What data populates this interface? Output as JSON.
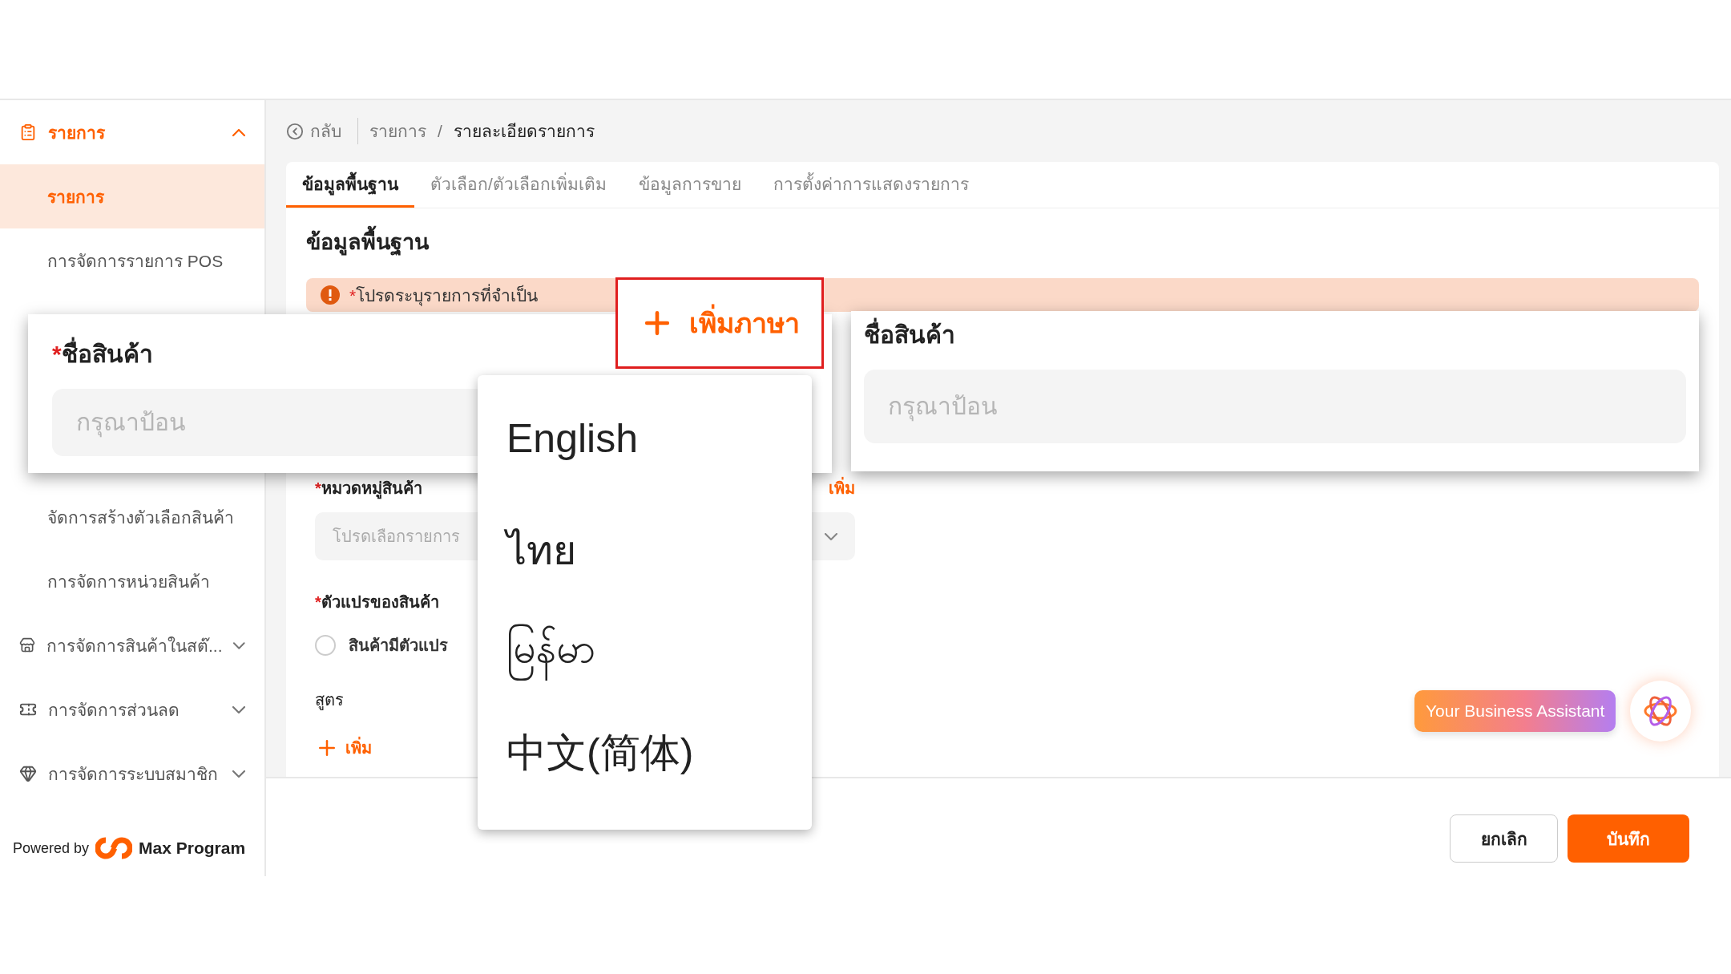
{
  "sidebar": {
    "group": {
      "label": "รายการ",
      "expanded": true
    },
    "items": [
      {
        "label": "รายการ",
        "selected": true
      },
      {
        "label": "การจัดการรายการ POS",
        "selected": false
      },
      {
        "label": "จัดการสร้างตัวเลือกสินค้า",
        "selected": false
      },
      {
        "label": "การจัดการหน่วยสินค้า",
        "selected": false
      }
    ],
    "sections": [
      {
        "kind": "store",
        "label": "การจัดการสินค้าในสต๊...",
        "expanded": false
      },
      {
        "kind": "discount",
        "label": "การจัดการส่วนลด",
        "expanded": false
      },
      {
        "kind": "member",
        "label": "การจัดการระบบสมาชิก",
        "expanded": false
      }
    ],
    "powered_by": "Powered by",
    "brand": "Max Program"
  },
  "breadcrumb": {
    "back": "กลับ",
    "items": [
      "รายการ",
      "รายละเอียดรายการ"
    ],
    "separator": "/"
  },
  "tabs": [
    {
      "label": "ข้อมูลพื้นฐาน",
      "selected": true
    },
    {
      "label": "ตัวเลือก/ตัวเลือกเพิ่มเติม",
      "selected": false
    },
    {
      "label": "ข้อมูลการขาย",
      "selected": false
    },
    {
      "label": "การตั้งค่าการแสดงรายการ",
      "selected": false
    }
  ],
  "section_title": "ข้อมูลพื้นฐาน",
  "alert": {
    "mark": "*",
    "text": "โปรดระบุรายการที่จำเป็น"
  },
  "category": {
    "mark": "*",
    "label": "หมวดหมู่สินค้า",
    "action": "เพิ่ม",
    "placeholder": "โปรดเลือกรายการ"
  },
  "variant": {
    "mark": "*",
    "label": "ตัวแปรของสินค้า",
    "option": {
      "label": "สินค้ามีตัวแปร",
      "checked": false
    }
  },
  "recipe": {
    "label": "สูตร",
    "add": "เพิ่ม"
  },
  "footer": {
    "cancel": "ยกเลิก",
    "save": "บันทึก"
  },
  "assistant": {
    "label": "Your Business Assistant"
  },
  "callouts": {
    "name_left": {
      "mark": "*",
      "label": "ชื่อสินค้า",
      "placeholder": "กรุณาป้อน"
    },
    "add_language": {
      "label": "เพิ่มภาษา"
    },
    "languages": [
      "English",
      "ไทย",
      "မြန်မာ",
      "中文(简体)"
    ],
    "name_right": {
      "label": "ชื่อสินค้า",
      "placeholder": "กรุณาป้อน"
    }
  }
}
